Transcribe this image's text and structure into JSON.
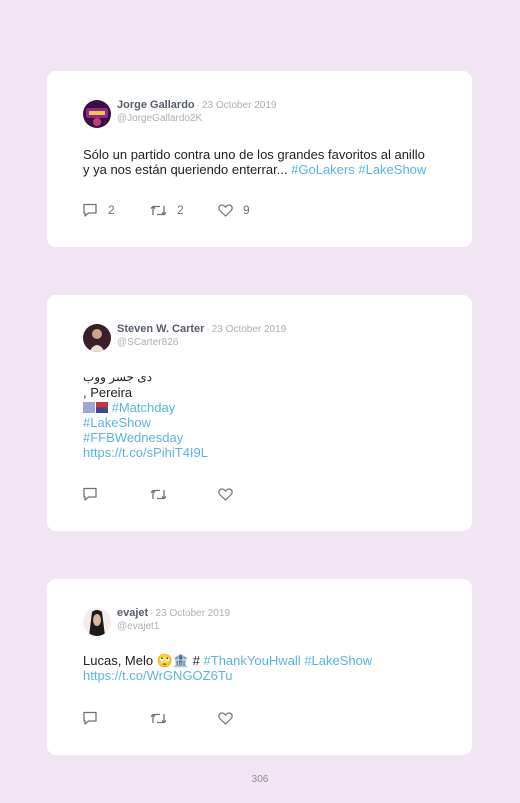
{
  "tweets": [
    {
      "name": "Jorge Gallardo",
      "separator": "·",
      "date": "23 October 2019",
      "handle": "@JorgeGallardo2K",
      "line1": "Sólo un partido contra uno de los grandes favoritos al anillo",
      "line2_text": "y ya nos están queriendo enterrar... ",
      "tag1": "#GoLakers",
      "tag2": "#LakeShow",
      "replies": "2",
      "retweets": "2",
      "likes": "9",
      "avatar_color": "#8b2a8f"
    },
    {
      "name": "Steven W. Carter",
      "separator": "·",
      "date": "23 October 2019",
      "handle": "@SCarter826",
      "line1": "دی جسر ووب",
      "line2": ", Pereira",
      "line3_tag": "#Matchday",
      "line4_tag": "#LakeShow",
      "line5_tag": "#FFBWednesday",
      "link": "https://t.co/sPihiT4I9L",
      "avatar_color": "#4a2a36"
    },
    {
      "name": "evajet",
      "separator": "·",
      "date": "23 October 2019",
      "handle": "@evajet1",
      "line1_text": "Lucas, Melo 🙄🏦 # ",
      "tag1": "#ThankYouHwall",
      "tag2": "#LakeShow",
      "link": "https://t.co/WrGNGOZ6Tu",
      "avatar_color": "#2a2a2a"
    }
  ],
  "page_number": "306"
}
